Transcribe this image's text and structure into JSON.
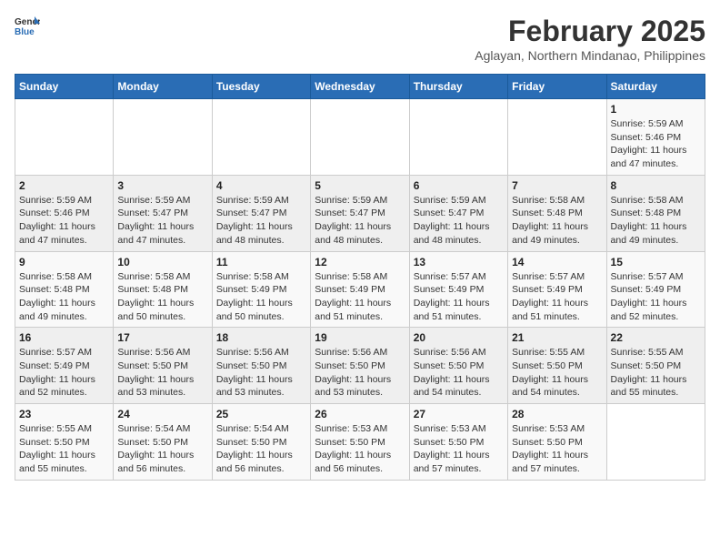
{
  "logo": {
    "line1": "General",
    "line2": "Blue"
  },
  "title": "February 2025",
  "subtitle": "Aglayan, Northern Mindanao, Philippines",
  "days_of_week": [
    "Sunday",
    "Monday",
    "Tuesday",
    "Wednesday",
    "Thursday",
    "Friday",
    "Saturday"
  ],
  "weeks": [
    [
      {
        "day": "",
        "info": ""
      },
      {
        "day": "",
        "info": ""
      },
      {
        "day": "",
        "info": ""
      },
      {
        "day": "",
        "info": ""
      },
      {
        "day": "",
        "info": ""
      },
      {
        "day": "",
        "info": ""
      },
      {
        "day": "1",
        "info": "Sunrise: 5:59 AM\nSunset: 5:46 PM\nDaylight: 11 hours\nand 47 minutes."
      }
    ],
    [
      {
        "day": "2",
        "info": "Sunrise: 5:59 AM\nSunset: 5:46 PM\nDaylight: 11 hours\nand 47 minutes."
      },
      {
        "day": "3",
        "info": "Sunrise: 5:59 AM\nSunset: 5:47 PM\nDaylight: 11 hours\nand 47 minutes."
      },
      {
        "day": "4",
        "info": "Sunrise: 5:59 AM\nSunset: 5:47 PM\nDaylight: 11 hours\nand 48 minutes."
      },
      {
        "day": "5",
        "info": "Sunrise: 5:59 AM\nSunset: 5:47 PM\nDaylight: 11 hours\nand 48 minutes."
      },
      {
        "day": "6",
        "info": "Sunrise: 5:59 AM\nSunset: 5:47 PM\nDaylight: 11 hours\nand 48 minutes."
      },
      {
        "day": "7",
        "info": "Sunrise: 5:58 AM\nSunset: 5:48 PM\nDaylight: 11 hours\nand 49 minutes."
      },
      {
        "day": "8",
        "info": "Sunrise: 5:58 AM\nSunset: 5:48 PM\nDaylight: 11 hours\nand 49 minutes."
      }
    ],
    [
      {
        "day": "9",
        "info": "Sunrise: 5:58 AM\nSunset: 5:48 PM\nDaylight: 11 hours\nand 49 minutes."
      },
      {
        "day": "10",
        "info": "Sunrise: 5:58 AM\nSunset: 5:48 PM\nDaylight: 11 hours\nand 50 minutes."
      },
      {
        "day": "11",
        "info": "Sunrise: 5:58 AM\nSunset: 5:49 PM\nDaylight: 11 hours\nand 50 minutes."
      },
      {
        "day": "12",
        "info": "Sunrise: 5:58 AM\nSunset: 5:49 PM\nDaylight: 11 hours\nand 51 minutes."
      },
      {
        "day": "13",
        "info": "Sunrise: 5:57 AM\nSunset: 5:49 PM\nDaylight: 11 hours\nand 51 minutes."
      },
      {
        "day": "14",
        "info": "Sunrise: 5:57 AM\nSunset: 5:49 PM\nDaylight: 11 hours\nand 51 minutes."
      },
      {
        "day": "15",
        "info": "Sunrise: 5:57 AM\nSunset: 5:49 PM\nDaylight: 11 hours\nand 52 minutes."
      }
    ],
    [
      {
        "day": "16",
        "info": "Sunrise: 5:57 AM\nSunset: 5:49 PM\nDaylight: 11 hours\nand 52 minutes."
      },
      {
        "day": "17",
        "info": "Sunrise: 5:56 AM\nSunset: 5:50 PM\nDaylight: 11 hours\nand 53 minutes."
      },
      {
        "day": "18",
        "info": "Sunrise: 5:56 AM\nSunset: 5:50 PM\nDaylight: 11 hours\nand 53 minutes."
      },
      {
        "day": "19",
        "info": "Sunrise: 5:56 AM\nSunset: 5:50 PM\nDaylight: 11 hours\nand 53 minutes."
      },
      {
        "day": "20",
        "info": "Sunrise: 5:56 AM\nSunset: 5:50 PM\nDaylight: 11 hours\nand 54 minutes."
      },
      {
        "day": "21",
        "info": "Sunrise: 5:55 AM\nSunset: 5:50 PM\nDaylight: 11 hours\nand 54 minutes."
      },
      {
        "day": "22",
        "info": "Sunrise: 5:55 AM\nSunset: 5:50 PM\nDaylight: 11 hours\nand 55 minutes."
      }
    ],
    [
      {
        "day": "23",
        "info": "Sunrise: 5:55 AM\nSunset: 5:50 PM\nDaylight: 11 hours\nand 55 minutes."
      },
      {
        "day": "24",
        "info": "Sunrise: 5:54 AM\nSunset: 5:50 PM\nDaylight: 11 hours\nand 56 minutes."
      },
      {
        "day": "25",
        "info": "Sunrise: 5:54 AM\nSunset: 5:50 PM\nDaylight: 11 hours\nand 56 minutes."
      },
      {
        "day": "26",
        "info": "Sunrise: 5:53 AM\nSunset: 5:50 PM\nDaylight: 11 hours\nand 56 minutes."
      },
      {
        "day": "27",
        "info": "Sunrise: 5:53 AM\nSunset: 5:50 PM\nDaylight: 11 hours\nand 57 minutes."
      },
      {
        "day": "28",
        "info": "Sunrise: 5:53 AM\nSunset: 5:50 PM\nDaylight: 11 hours\nand 57 minutes."
      },
      {
        "day": "",
        "info": ""
      }
    ]
  ]
}
